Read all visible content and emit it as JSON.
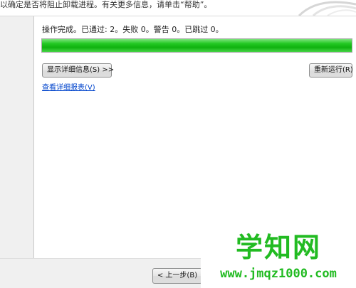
{
  "banner": {
    "text": "以确定是否将阻止卸载进程。有关更多信息，请单击“帮助”。"
  },
  "main": {
    "status_text": "操作完成。已通过: 2。失败 0。警告 0。已跳过 0。",
    "progress_percent": 100,
    "show_details_label": "显示详细信息(S) >>",
    "rerun_label": "重新运行(R)",
    "report_link": "查看详细报表(V)"
  },
  "footer": {
    "back_label": "< 上一步(B)"
  },
  "watermark": {
    "title": "学知网",
    "url": "www.jmqz1000.com"
  },
  "colors": {
    "progress_green": "#0fb20f",
    "link_blue": "#0044cc",
    "watermark_green": "#22bb22"
  }
}
